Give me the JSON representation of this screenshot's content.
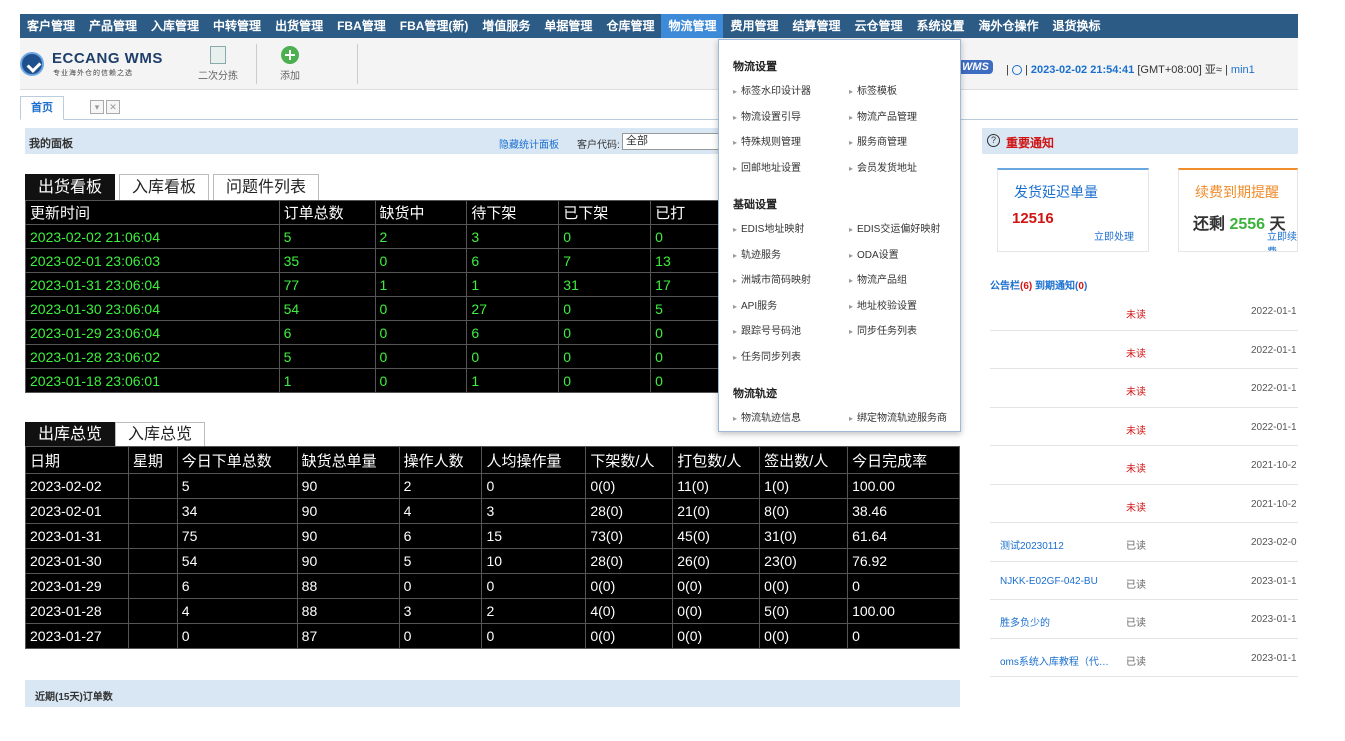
{
  "topnav": {
    "items": [
      "客户管理",
      "产品管理",
      "入库管理",
      "中转管理",
      "出货管理",
      "FBA管理",
      "FBA管理(新)",
      "增值服务",
      "单据管理",
      "仓库管理",
      "物流管理",
      "费用管理",
      "结算管理",
      "云仓管理",
      "系统设置",
      "海外仓操作",
      "退货换标"
    ],
    "active_index": 10
  },
  "toolbar": {
    "logo_title": "ECCANG WMS",
    "logo_sub": "专业海外仓的信赖之选",
    "secondary_sort_label": "二次分拣",
    "add_label": "添加",
    "wms_badge": "WMS",
    "sep1": "|",
    "sep2": "|",
    "datetime": "2023-02-02 21:54:41",
    "timezone": "[GMT+08:00] 亚≈",
    "sep3": "|",
    "user": "min1"
  },
  "tabs": {
    "home": "首页"
  },
  "panel": {
    "title": "我的面板",
    "hide_stats": "隐藏统计面板",
    "customer_code_label": "客户代码:",
    "customer_code_value": "全部"
  },
  "board_tabs": [
    "出货看板",
    "入库看板",
    "问题件列表"
  ],
  "board": {
    "headers": [
      "更新时间",
      "订单总数",
      "缺货中",
      "待下架",
      "已下架",
      "已打"
    ],
    "rows": [
      [
        "2023-02-02 21:06:04",
        "5",
        "2",
        "3",
        "0",
        "0"
      ],
      [
        "2023-02-01 23:06:03",
        "35",
        "0",
        "6",
        "7",
        "13"
      ],
      [
        "2023-01-31 23:06:04",
        "77",
        "1",
        "1",
        "31",
        "17"
      ],
      [
        "2023-01-30 23:06:04",
        "54",
        "0",
        "27",
        "0",
        "5"
      ],
      [
        "2023-01-29 23:06:04",
        "6",
        "0",
        "6",
        "0",
        "0"
      ],
      [
        "2023-01-28 23:06:02",
        "5",
        "0",
        "0",
        "0",
        "0"
      ],
      [
        "2023-01-18 23:06:01",
        "1",
        "0",
        "1",
        "0",
        "0"
      ]
    ]
  },
  "overview_tabs": [
    "出库总览",
    "入库总览"
  ],
  "overview": {
    "headers": [
      "日期",
      "星期",
      "今日下单总数",
      "缺货总单量",
      "操作人数",
      "人均操作量",
      "下架数/人",
      "打包数/人",
      "签出数/人",
      "今日完成率"
    ],
    "rows": [
      [
        "2023-02-02",
        "",
        "5",
        "90",
        "2",
        "0",
        "0(0)",
        "11(0)",
        "1(0)",
        "100.00"
      ],
      [
        "2023-02-01",
        "",
        "34",
        "90",
        "4",
        "3",
        "28(0)",
        "21(0)",
        "8(0)",
        "38.46"
      ],
      [
        "2023-01-31",
        "",
        "75",
        "90",
        "6",
        "15",
        "73(0)",
        "45(0)",
        "31(0)",
        "61.64"
      ],
      [
        "2023-01-30",
        "",
        "54",
        "90",
        "5",
        "10",
        "28(0)",
        "26(0)",
        "23(0)",
        "76.92"
      ],
      [
        "2023-01-29",
        "",
        "6",
        "88",
        "0",
        "0",
        "0(0)",
        "0(0)",
        "0(0)",
        "0"
      ],
      [
        "2023-01-28",
        "",
        "4",
        "88",
        "3",
        "2",
        "4(0)",
        "0(0)",
        "5(0)",
        "100.00"
      ],
      [
        "2023-01-27",
        "",
        "0",
        "87",
        "0",
        "0",
        "0(0)",
        "0(0)",
        "0(0)",
        "0"
      ]
    ]
  },
  "recent_orders_title": "近期(15天)订单数",
  "notice": {
    "title": "重要通知",
    "card1_title": "发货延迟单量",
    "card1_value": "12516",
    "card1_link": "立即处理",
    "card2_title": "续费到期提醒",
    "card2_prefix": "还剩",
    "card2_days": "2556",
    "card2_suffix": "天",
    "card2_link": "立即续费"
  },
  "bulletin": {
    "label": "公告栏",
    "count_open": "(",
    "count": "6",
    "count_close": ")",
    "expire_label": "到期通知",
    "expire_count": "0",
    "rows": [
      {
        "title": "",
        "status": "未读",
        "date": "2022-01-1",
        "unread": true
      },
      {
        "title": "",
        "status": "未读",
        "date": "2022-01-1",
        "unread": true
      },
      {
        "title": "",
        "status": "未读",
        "date": "2022-01-1",
        "unread": true
      },
      {
        "title": "",
        "status": "未读",
        "date": "2022-01-1",
        "unread": true
      },
      {
        "title": "",
        "status": "未读",
        "date": "2021-10-2",
        "unread": true
      },
      {
        "title": "",
        "status": "未读",
        "date": "2021-10-2",
        "unread": true
      },
      {
        "title": "测试20230112",
        "status": "已读",
        "date": "2023-02-0",
        "unread": false
      },
      {
        "title": "NJKK-E02GF-042-BU",
        "status": "已读",
        "date": "2023-01-1",
        "unread": false
      },
      {
        "title": "胜多负少的",
        "status": "已读",
        "date": "2023-01-1",
        "unread": false
      },
      {
        "title": "oms系统入库教程（代…",
        "status": "已读",
        "date": "2023-01-1",
        "unread": false
      }
    ]
  },
  "dropdown": {
    "sections": [
      {
        "title": "物流设置",
        "items": [
          "标签水印设计器",
          "标签模板",
          "物流设置引导",
          "物流产品管理",
          "特殊规则管理",
          "服务商管理",
          "回邮地址设置",
          "会员发货地址"
        ]
      },
      {
        "title": "基础设置",
        "items": [
          "EDIS地址映射",
          "EDIS交运偏好映射",
          "轨迹服务",
          "ODA设置",
          "洲城市简码映射",
          "物流产品组",
          "API服务",
          "地址校验设置",
          "跟踪号号码池",
          "同步任务列表",
          "任务同步列表"
        ]
      },
      {
        "title": "物流轨迹",
        "items": [
          "物流轨迹信息",
          "绑定物流轨迹服务商"
        ]
      }
    ]
  }
}
